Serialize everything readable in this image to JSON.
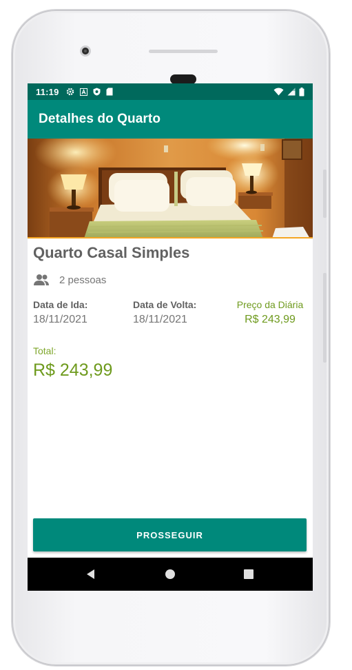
{
  "status_bar": {
    "time": "11:19",
    "icons": [
      "gear-icon",
      "font-icon",
      "shield-icon",
      "sd-card-icon"
    ],
    "right_icons": [
      "wifi-icon",
      "signal-icon",
      "battery-icon"
    ]
  },
  "app_bar": {
    "title": "Detalhes do Quarto"
  },
  "room": {
    "image_alt": "bedroom-photo",
    "title": "Quarto Casal Simples",
    "capacity": "2 pessoas",
    "checkin_label": "Data de Ida:",
    "checkin_value": "18/11/2021",
    "checkout_label": "Data de Volta:",
    "checkout_value": "18/11/2021",
    "daily_price_label": "Preço da Diária",
    "daily_price_value": "R$ 243,99",
    "total_label": "Total:",
    "total_value": "R$ 243,99"
  },
  "actions": {
    "proceed_label": "PROSSEGUIR"
  },
  "nav_bar": {
    "buttons": [
      "back-icon",
      "home-icon",
      "recents-icon"
    ]
  },
  "colors": {
    "primary": "#00897b",
    "primary_dark": "#00695c",
    "price_green": "#6e9a1d",
    "text_gray": "#616161"
  }
}
